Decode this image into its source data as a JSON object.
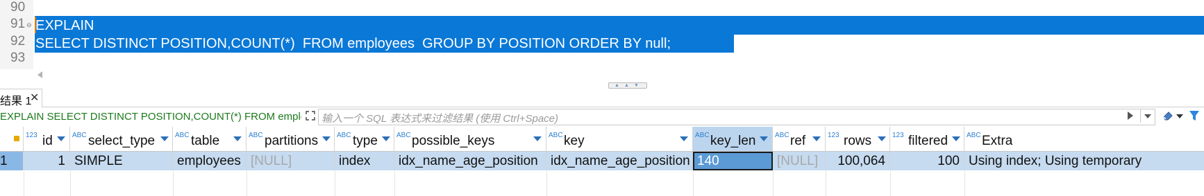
{
  "editor": {
    "line_numbers": [
      "90",
      "91",
      "92",
      "93"
    ],
    "lines": [
      {
        "text": "EXPLAIN"
      },
      {
        "text": "SELECT DISTINCT POSITION,COUNT(*)  FROM employees  GROUP BY POSITION ORDER BY null;"
      }
    ]
  },
  "results": {
    "tab_label": "结果 1",
    "query_text": "EXPLAIN SELECT DISTINCT POSITION,COUNT(*) FROM emplo",
    "filter_placeholder": "输入一个 SQL 表达式来过滤结果 (使用 Ctrl+Space)",
    "columns": [
      {
        "type": "123",
        "name": "id"
      },
      {
        "type": "ABC",
        "name": "select_type"
      },
      {
        "type": "ABC",
        "name": "table"
      },
      {
        "type": "ABC",
        "name": "partitions"
      },
      {
        "type": "ABC",
        "name": "type"
      },
      {
        "type": "ABC",
        "name": "possible_keys"
      },
      {
        "type": "ABC",
        "name": "key"
      },
      {
        "type": "ABC",
        "name": "key_len"
      },
      {
        "type": "ABC",
        "name": "ref"
      },
      {
        "type": "123",
        "name": "rows"
      },
      {
        "type": "123",
        "name": "filtered"
      },
      {
        "type": "ABC",
        "name": "Extra"
      }
    ],
    "row": {
      "num": "1",
      "id": "1",
      "select_type": "SIMPLE",
      "table": "employees",
      "partitions": "[NULL]",
      "type": "index",
      "possible_keys": "idx_name_age_position",
      "key": "idx_name_age_position",
      "key_len": "140",
      "ref": "[NULL]",
      "rows": "100,064",
      "filtered": "100",
      "Extra": "Using index; Using temporary"
    }
  },
  "colors": {
    "selection": "#0a78d7",
    "row_selected": "#c6dbf0",
    "active_header": "#bcd5ee",
    "query_green": "#1b7a1b"
  }
}
